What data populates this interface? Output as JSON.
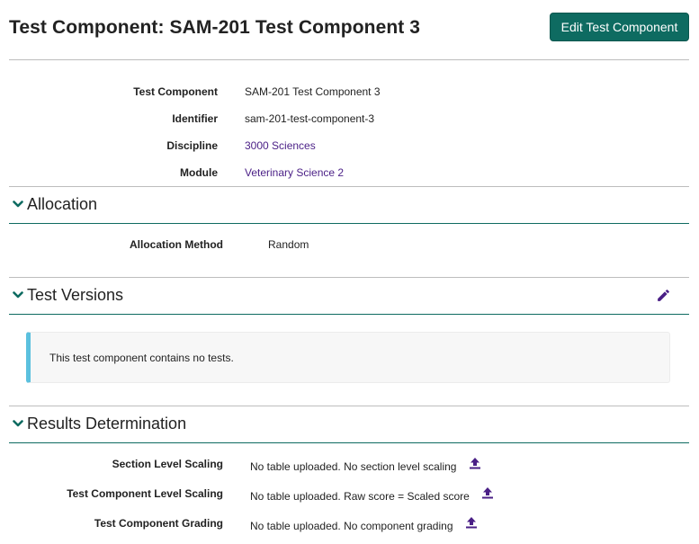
{
  "header": {
    "title": "Test Component: SAM-201 Test Component 3",
    "edit_button": "Edit Test Component"
  },
  "details": {
    "rows": [
      {
        "label": "Test Component",
        "value": "SAM-201 Test Component 3"
      },
      {
        "label": "Identifier",
        "value": "sam-201-test-component-3"
      },
      {
        "label": "Discipline",
        "value": "3000 Sciences"
      },
      {
        "label": "Module",
        "value": "Veterinary Science 2"
      }
    ]
  },
  "allocation": {
    "title": "Allocation",
    "method_label": "Allocation Method",
    "method_value": "Random"
  },
  "test_versions": {
    "title": "Test Versions",
    "empty_message": "This test component contains no tests."
  },
  "results": {
    "title": "Results Determination",
    "rows": [
      {
        "label": "Section Level Scaling",
        "value": "No table uploaded. No section level scaling"
      },
      {
        "label": "Test Component Level Scaling",
        "value": "No table uploaded. Raw score = Scaled score"
      },
      {
        "label": "Test Component Grading",
        "value": "No table uploaded. No component grading"
      }
    ]
  },
  "colors": {
    "primary": "#0e6b61",
    "link": "#4a1f86",
    "icon": "#4a1f86",
    "info_border": "#5bc0de"
  },
  "icons": {
    "section_toggle": "chevron-down-icon",
    "edit_versions": "pencil-icon",
    "upload": "upload-icon"
  }
}
